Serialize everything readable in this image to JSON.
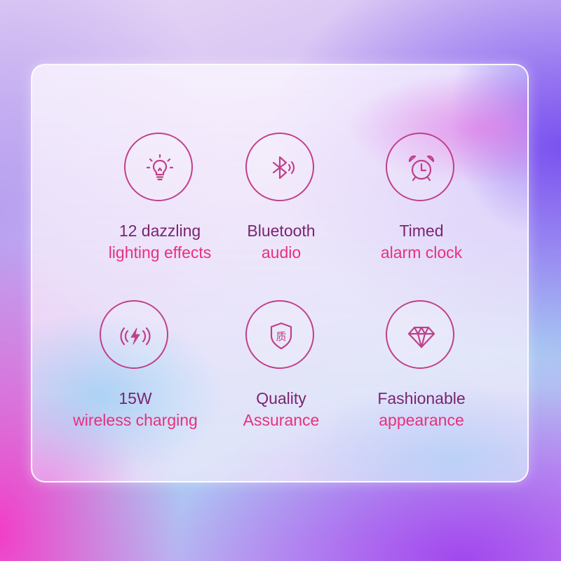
{
  "colors": {
    "icon_stroke": "#c0408a",
    "title_text": "#7a2470",
    "accent_text": "#e8307e"
  },
  "features": [
    {
      "icon": "lightbulb-icon",
      "line1": "12 dazzling",
      "line2": "lighting effects"
    },
    {
      "icon": "bluetooth-icon",
      "line1": "Bluetooth",
      "line2": "audio"
    },
    {
      "icon": "alarm-clock-icon",
      "line1": "Timed",
      "line2": "alarm clock"
    },
    {
      "icon": "wireless-charging-icon",
      "line1": "15W",
      "line2": "wireless charging"
    },
    {
      "icon": "quality-shield-icon",
      "icon_glyph": "质",
      "line1": "Quality",
      "line2": "Assurance"
    },
    {
      "icon": "diamond-icon",
      "line1": "Fashionable",
      "line2": "appearance"
    }
  ]
}
